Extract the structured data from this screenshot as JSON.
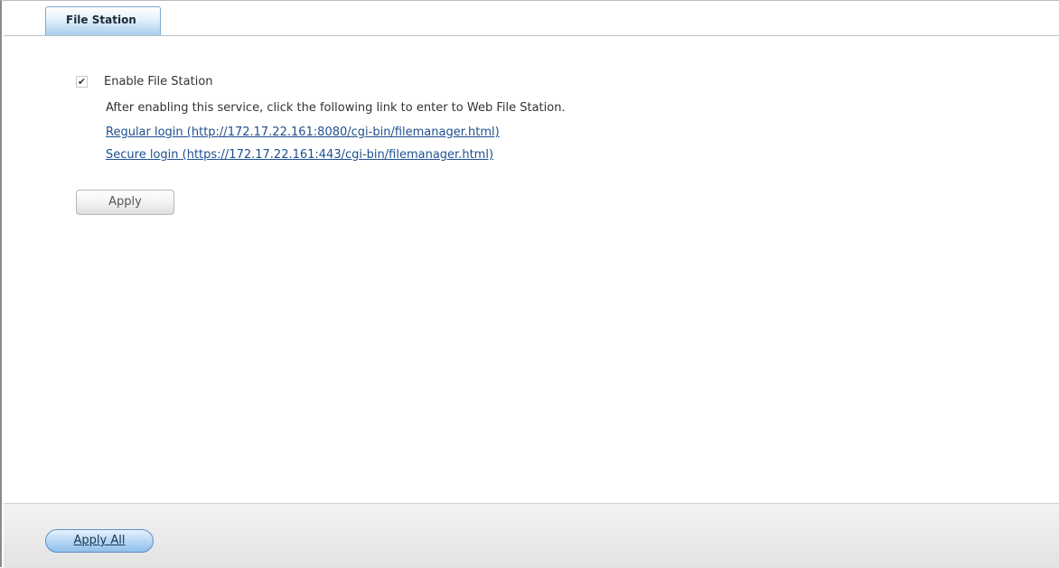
{
  "tabs": [
    {
      "label": "File Station",
      "active": true
    }
  ],
  "settings": {
    "enable_label": "Enable File Station",
    "enable_checked": true,
    "description": "After enabling this service, click the following link to enter to Web File Station.",
    "regular_login_link": "Regular login (http://172.17.22.161:8080/cgi-bin/filemanager.html)",
    "secure_login_link": "Secure login (https://172.17.22.161:443/cgi-bin/filemanager.html)",
    "apply_label": "Apply"
  },
  "footer": {
    "apply_all_label": "Apply All"
  },
  "colors": {
    "tab_active": "#a9cdee",
    "link": "#1f4f8f",
    "apply_all_button": "#8fbfea"
  }
}
